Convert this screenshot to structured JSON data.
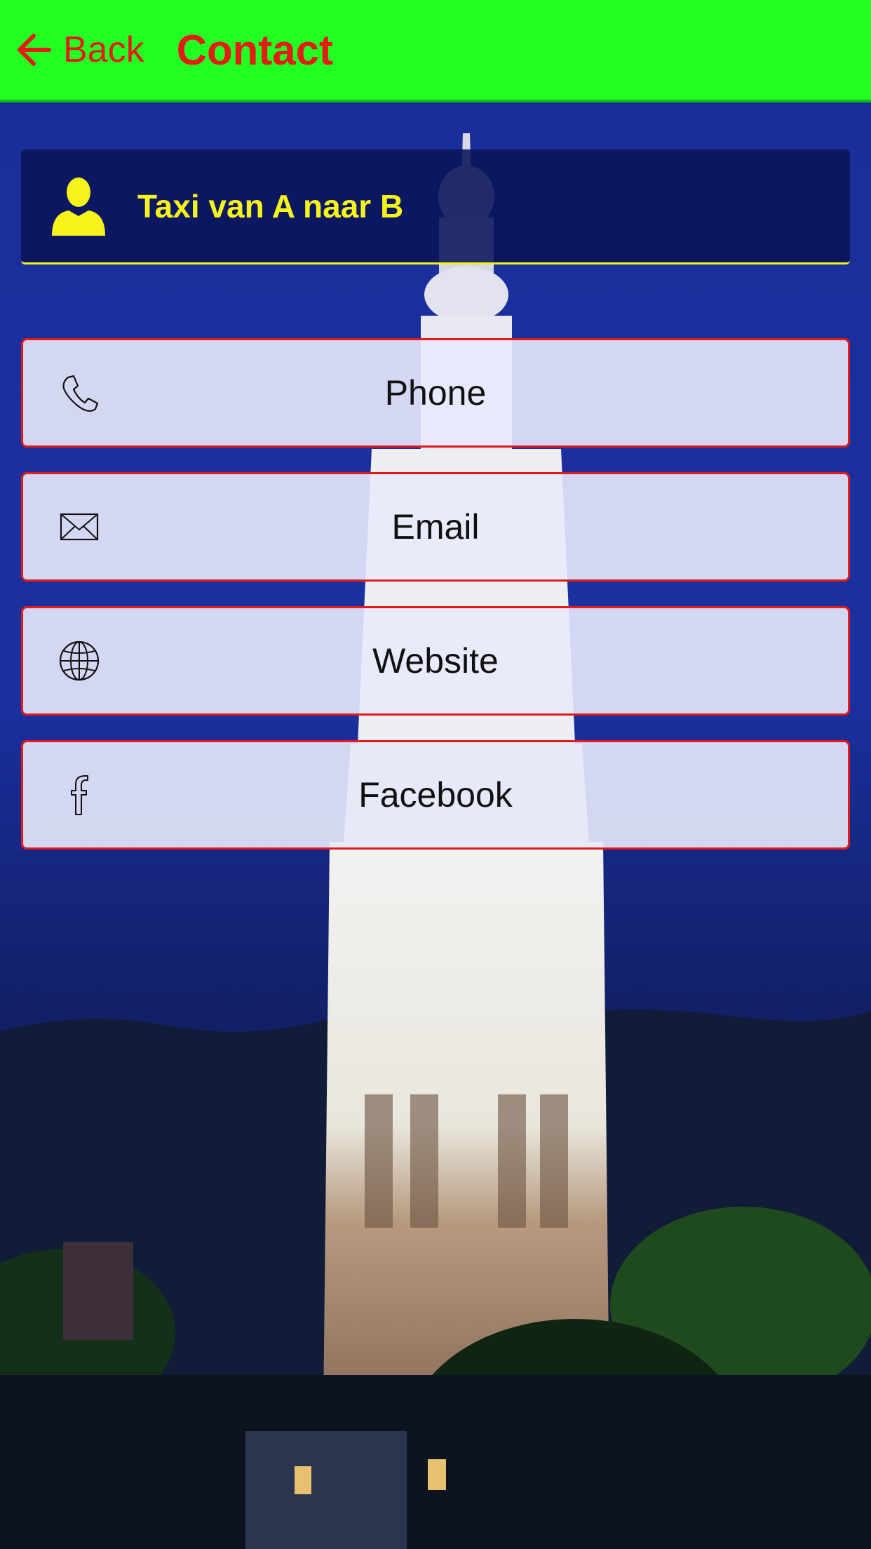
{
  "header": {
    "back_label": "Back",
    "title": "Contact",
    "background_color": "#22ff22",
    "text_color": "#e41b17"
  },
  "profile": {
    "name": "Taxi van A naar B",
    "icon": "person-icon",
    "accent_color": "#f6f31c"
  },
  "buttons": [
    {
      "label": "Phone",
      "icon": "phone-icon"
    },
    {
      "label": "Email",
      "icon": "envelope-icon"
    },
    {
      "label": "Website",
      "icon": "globe-icon"
    },
    {
      "label": "Facebook",
      "icon": "facebook-icon"
    }
  ],
  "button_border_color": "#e01b1b"
}
